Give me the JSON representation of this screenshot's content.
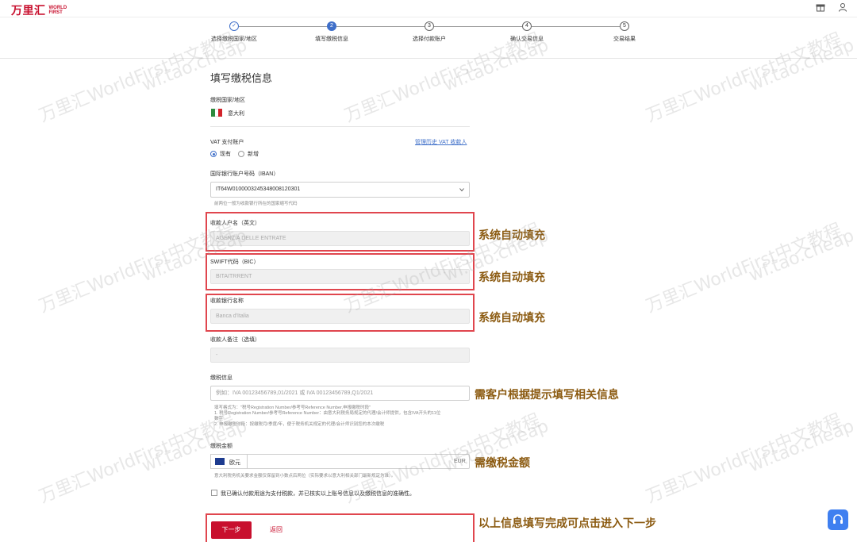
{
  "header": {
    "logo_cn": "万里汇",
    "logo_en_1": "WORLD",
    "logo_en_2": "FIRST"
  },
  "steps": [
    {
      "num": "✓",
      "label": "选择缴税国家/地区",
      "state": "done"
    },
    {
      "num": "2",
      "label": "填写缴税信息",
      "state": "active"
    },
    {
      "num": "3",
      "label": "选择付款账户",
      "state": "todo"
    },
    {
      "num": "4",
      "label": "确认交易信息",
      "state": "todo"
    },
    {
      "num": "5",
      "label": "交易结果",
      "state": "todo"
    }
  ],
  "form": {
    "title": "填写缴税信息",
    "country_label": "缴税国家/地区",
    "country_value": "意大利",
    "vat_label": "VAT 支付账户",
    "radio_existing": "现有",
    "radio_new": "新增",
    "manage_link": "管理历史 VAT 收款人",
    "iban_label": "国际银行账户号码（IBAN）",
    "iban_value": "IT64W0100003245348008120301",
    "iban_helper": "前两位一般为收款银行所在的国家缩写代码",
    "payee_label": "收款人户名（英文）",
    "payee_value": "AGENZIA DELLE ENTRATE",
    "swift_label": "SWIFT代码（BIC）",
    "swift_value": "BITAITRRENT",
    "bank_label": "收款银行名称",
    "bank_value": "Banca d'Italia",
    "remark_label": "收款人备注（选填）",
    "remark_value": "-",
    "tax_info_label": "缴税信息",
    "tax_info_placeholder": "例如：IVA 00123456789,01/2021 或 IVA 00123456789,Q1/2021",
    "tax_helper_1": "填写格式为：\"税号Registration Number/参考号Reference Number,申报缴税时段\"",
    "tax_helper_2": "1. 税号Registration Number/参考号Reference Number：由意大利税务局规定的代理/会计师提供，包含IVA开头的11位",
    "tax_helper_3": "数字",
    "tax_helper_4": "2. 申报缴税时段：按缴税月/季度/年，便于税务机关规定的代理/会计师识别您的本次缴税",
    "amount_label": "缴税金额",
    "currency_name": "欧元",
    "currency_code": "EUR",
    "amount_helper": "意大利税务机关要求金额仅保留到小数点后两位（实际要求以意大利相关部门最新规定为准）。",
    "confirm_text": "我已确认付款用途为支付税款，并已核实以上账号信息以及缴税信息的准确性。",
    "next_button": "下一步",
    "back_button": "返回"
  },
  "annotations": {
    "auto_fill_1": "系统自动填充",
    "auto_fill_2": "系统自动填充",
    "auto_fill_3": "系统自动填充",
    "tax_info_note": "需客户根据提示填写相关信息",
    "amount_note": "需缴税金额",
    "next_note": "以上信息填写完成可点击进入下一步"
  },
  "watermarks": [
    "万里汇WorldFirst中文教程",
    "wf.tao.cheap"
  ],
  "colors": {
    "brand": "#c8102e",
    "accent": "#3f6fc9",
    "annotation": "#8b5a10",
    "highlight_box": "#e0464e"
  },
  "icons": {
    "gift": "gift-icon",
    "user": "user-icon",
    "help": "headset-icon"
  }
}
